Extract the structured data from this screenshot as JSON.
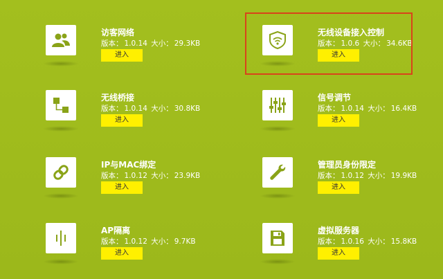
{
  "labels": {
    "version": "版本：",
    "size": "大小：",
    "enter": "进入"
  },
  "apps": [
    {
      "name": "访客网络",
      "version": "1.0.14",
      "size": "29.3KB",
      "icon": "guest-network-icon"
    },
    {
      "name": "无线设备接入控制",
      "version": "1.0.6",
      "size": "34.6KB",
      "icon": "wireless-shield-icon"
    },
    {
      "name": "无线桥接",
      "version": "1.0.14",
      "size": "30.8KB",
      "icon": "bridge-icon"
    },
    {
      "name": "信号调节",
      "version": "1.0.14",
      "size": "16.4KB",
      "icon": "signal-slider-icon"
    },
    {
      "name": "IP与MAC绑定",
      "version": "1.0.12",
      "size": "23.9KB",
      "icon": "link-chain-icon"
    },
    {
      "name": "管理员身份限定",
      "version": "1.0.12",
      "size": "19.9KB",
      "icon": "wrench-icon"
    },
    {
      "name": "AP隔离",
      "version": "1.0.12",
      "size": "9.7KB",
      "icon": "ap-isolation-icon"
    },
    {
      "name": "虚拟服务器",
      "version": "1.0.16",
      "size": "15.8KB",
      "icon": "virtual-server-icon"
    }
  ],
  "colors": {
    "background": "#9fbb1c",
    "button": "#fff000",
    "highlight_border": "#d9431a",
    "icon_stroke": "#8aa318"
  }
}
